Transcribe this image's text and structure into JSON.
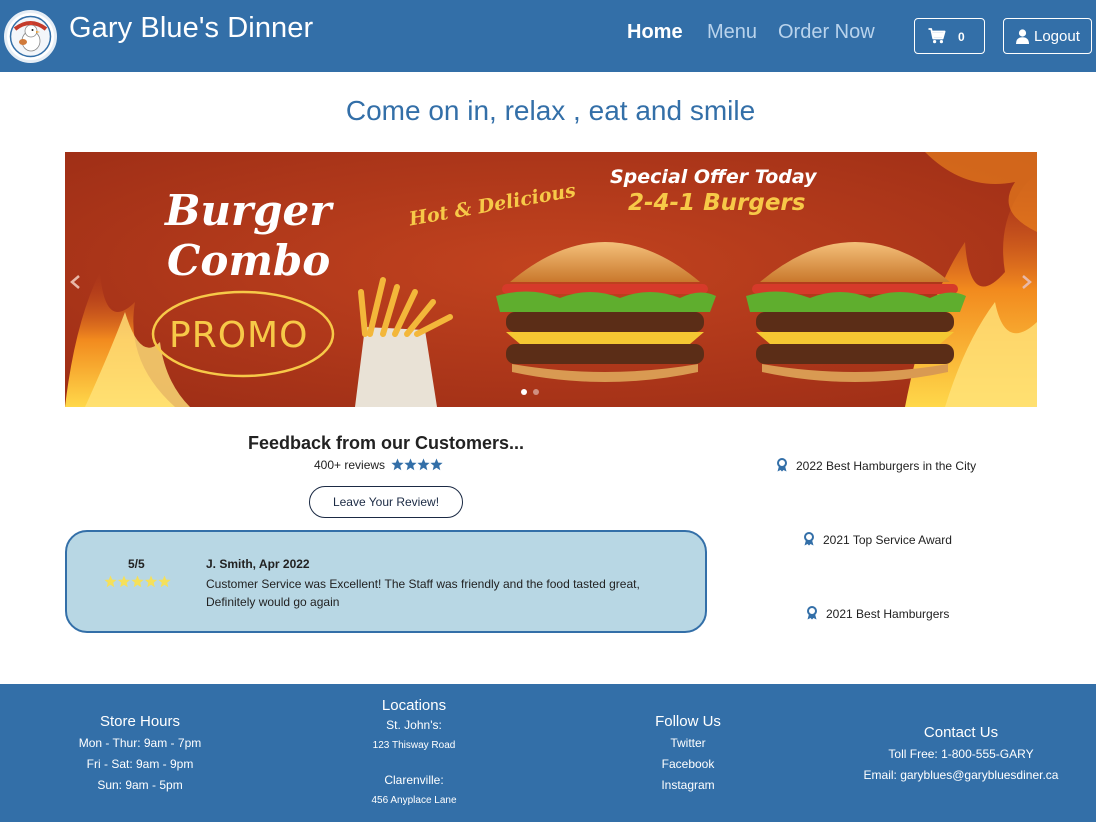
{
  "header": {
    "brand": "Gary Blue's Dinner",
    "nav": {
      "home": "Home",
      "menu": "Menu",
      "order": "Order Now"
    },
    "cart_count": "0",
    "logout_label": "Logout",
    "logo_icon": "chicken-mascot-logo"
  },
  "tagline": "Come on in, relax , eat and smile",
  "carousel": {
    "slide_title_1": "Burger",
    "slide_title_2": "Combo",
    "slide_hot": "Hot & Delicious",
    "slide_special": "Special Offer Today",
    "slide_deal": "2-4-1 Burgers",
    "slide_promo": "PROMO",
    "active_slide": 1,
    "slide_count": 2
  },
  "feedback": {
    "title": "Feedback from our Customers...",
    "review_count": "400+ reviews",
    "average_rating": 4.5,
    "button_label": "Leave Your Review!",
    "review": {
      "score": "5/5",
      "rating": 5,
      "author": "J. Smith, Apr 2022",
      "text": "Customer Service was Excellent! The Staff was friendly and the food tasted great, Definitely would go again"
    }
  },
  "awards": [
    {
      "label": "2022 Best Hamburgers in the City"
    },
    {
      "label": "2021 Top Service Award"
    },
    {
      "label": "2021 Best Hamburgers"
    }
  ],
  "footer": {
    "hours": {
      "heading": "Store Hours",
      "lines": [
        "Mon - Thur: 9am - 7pm",
        "Fri - Sat: 9am - 9pm",
        "Sun: 9am - 5pm"
      ]
    },
    "locations": {
      "heading": "Locations",
      "items": [
        {
          "city": "St. John's:",
          "address": "123 Thisway Road"
        },
        {
          "city": "Clarenville:",
          "address": "456 Anyplace Lane"
        }
      ]
    },
    "follow": {
      "heading": "Follow Us",
      "links": [
        "Twitter",
        "Facebook",
        "Instagram"
      ]
    },
    "contact": {
      "heading": "Contact Us",
      "phone": "Toll Free: 1-800-555-GARY",
      "email": "Email: garyblues@garybluesdiner.ca"
    }
  },
  "colors": {
    "primary": "#336fa8",
    "nav_inactive": "#b9d3ec",
    "review_card_bg": "#b8d7e4",
    "star_yellow": "#f5e05a"
  }
}
